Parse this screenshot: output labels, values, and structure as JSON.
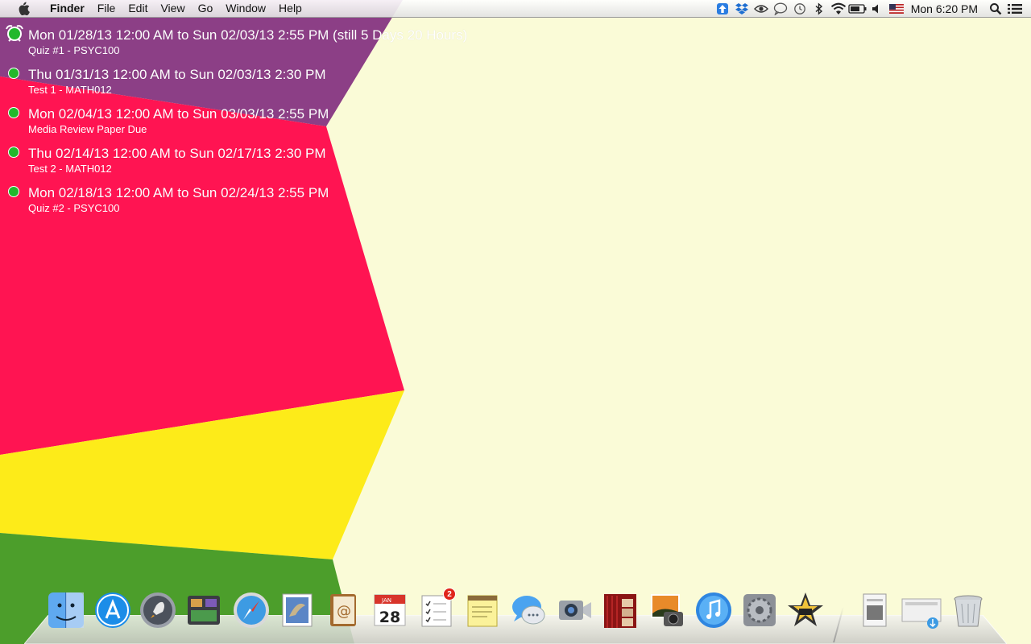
{
  "menubar": {
    "apple_icon": "apple-logo-icon",
    "app_name": "Finder",
    "items": [
      "File",
      "Edit",
      "View",
      "Go",
      "Window",
      "Help"
    ],
    "status_icons": [
      "upload-arrow-icon",
      "dropbox-icon",
      "eye-icon",
      "speech-bubble-icon",
      "time-machine-icon",
      "bluetooth-icon",
      "wifi-icon",
      "battery-icon",
      "volume-icon",
      "us-flag-icon"
    ],
    "clock": "Mon 6:20 PM",
    "spotlight_icon": "spotlight-search-icon",
    "notification_icon": "notification-center-icon"
  },
  "events": [
    {
      "when": "Mon 01/28/13 12:00 AM to Sun 02/03/13 2:55 PM (still 5 Days 20 Hours)",
      "title": "Quiz #1 - PSYC100",
      "alarm": true
    },
    {
      "when": "Thu 01/31/13 12:00 AM to Sun 02/03/13 2:30 PM",
      "title": "Test 1 - MATH012",
      "alarm": false
    },
    {
      "when": "Mon 02/04/13 12:00 AM to Sun 03/03/13 2:55 PM",
      "title": "Media Review Paper Due",
      "alarm": false
    },
    {
      "when": "Thu 02/14/13 12:00 AM to Sun 02/17/13 2:30 PM",
      "title": "Test 2 - MATH012",
      "alarm": false
    },
    {
      "when": "Mon 02/18/13 12:00 AM to Sun 02/24/13 2:55 PM",
      "title": "Quiz #2 - PSYC100",
      "alarm": false
    }
  ],
  "calendar_icon": {
    "month": "JAN",
    "day": "28"
  },
  "reminders_badge": "2",
  "dock": [
    "Finder",
    "App Store",
    "Launchpad",
    "Mission Control",
    "Safari",
    "Mail",
    "Contacts",
    "Calendar",
    "Reminders",
    "Notes",
    "Messages",
    "FaceTime",
    "Photo Booth",
    "iPhoto",
    "iTunes",
    "System Preferences",
    "iMovie",
    "Documents",
    "Downloads",
    "Trash"
  ],
  "colors": {
    "wallpaper_purple": "#8c3f86",
    "wallpaper_pink": "#ff1452",
    "wallpaper_yellow": "#fdeb19",
    "wallpaper_green": "#4c9e2b",
    "wallpaper_cream": "#fafbd7",
    "event_dot": "#22b82c"
  }
}
